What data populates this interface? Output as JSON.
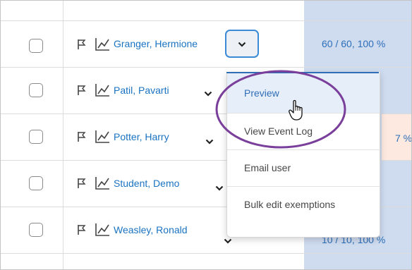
{
  "rows": [
    {
      "name": "Granger, Hermione",
      "score": "60 / 60, 100 %"
    },
    {
      "name": "Patil, Pavarti",
      "score": ""
    },
    {
      "name": "Potter, Harry",
      "score": "7 %"
    },
    {
      "name": "Student, Demo",
      "score": ""
    },
    {
      "name": "Weasley, Ronald",
      "score": "10 / 10, 100 %"
    }
  ],
  "context_menu": {
    "items": [
      "Preview",
      "View Event Log",
      "Email user",
      "Bulk edit exemptions"
    ],
    "active_item": "Preview"
  },
  "colors": {
    "link": "#1a73c1",
    "score_column": "#cfdcf0",
    "flagged_cell": "#fde9df",
    "menu_hover": "#e6eefa",
    "annotation_circle": "#7a3f9a"
  },
  "icons": {
    "flag": "flag-icon",
    "chart": "grades-chart-icon",
    "chevron": "chevron-down-icon",
    "cursor": "hand-pointer-icon"
  }
}
